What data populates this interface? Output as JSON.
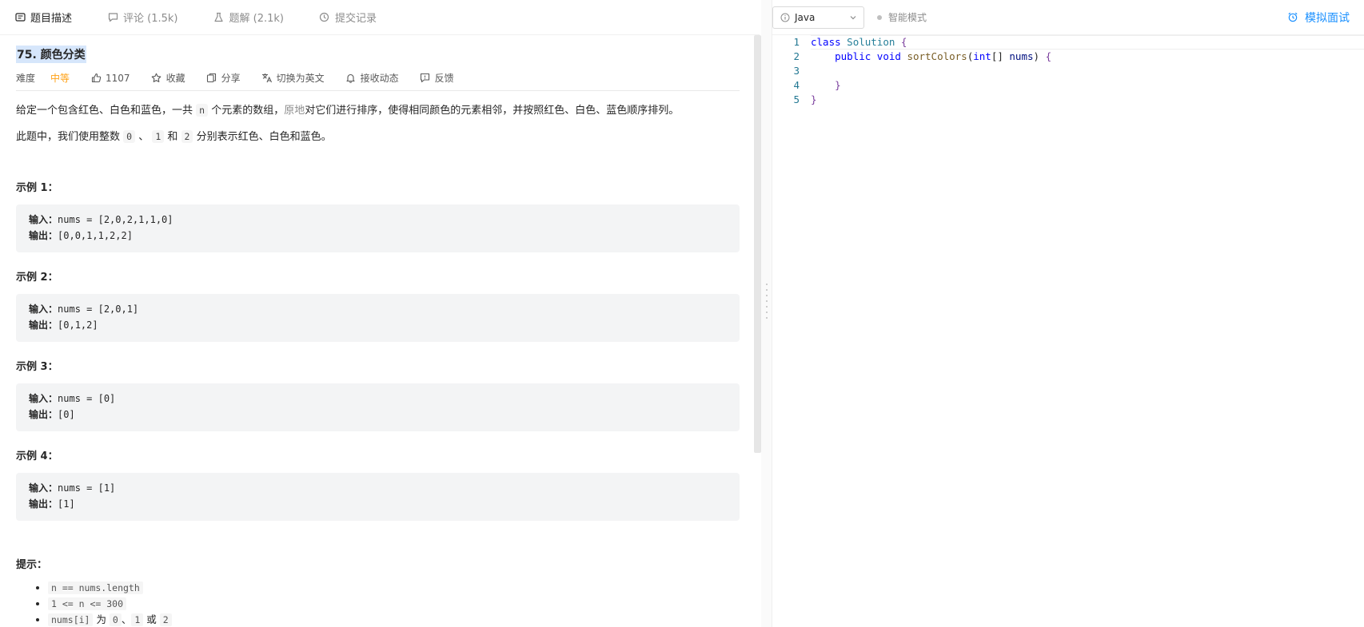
{
  "tabs": [
    {
      "label": "题目描述",
      "icon": "description-icon",
      "active": true
    },
    {
      "label": "评论 (1.5k)",
      "icon": "comment-icon",
      "active": false
    },
    {
      "label": "题解 (2.1k)",
      "icon": "flask-icon",
      "active": false
    },
    {
      "label": "提交记录",
      "icon": "clock-icon",
      "active": false
    }
  ],
  "problem": {
    "title": "75. 颜色分类",
    "difficulty_label": "难度",
    "difficulty": "中等",
    "likes": "1107",
    "actions": {
      "favorite": "收藏",
      "share": "分享",
      "switch_lang": "切换为英文",
      "subscribe": "接收动态",
      "feedback": "反馈"
    },
    "desc1": {
      "p1": "给定一个包含红色、白色和蓝色，一共 ",
      "code1": "n",
      "p2": " 个元素的数组，",
      "link": "原地",
      "p3": "对它们进行排序，使得相同颜色的元素相邻，并按照红色、白色、蓝色顺序排列。"
    },
    "desc2": {
      "p1": "此题中，我们使用整数 ",
      "c0": "0",
      "sep1": " 、 ",
      "c1": "1",
      "sep2": " 和 ",
      "c2": "2",
      "p2": " 分别表示红色、白色和蓝色。"
    },
    "input_label": "输入：",
    "output_label": "输出：",
    "examples": [
      {
        "title": "示例 1：",
        "input": "nums = [2,0,2,1,1,0]",
        "output": "[0,0,1,1,2,2]"
      },
      {
        "title": "示例 2：",
        "input": "nums = [2,0,1]",
        "output": "[0,1,2]"
      },
      {
        "title": "示例 3：",
        "input": "nums = [0]",
        "output": "[0]"
      },
      {
        "title": "示例 4：",
        "input": "nums = [1]",
        "output": "[1]"
      }
    ],
    "hints_title": "提示：",
    "hints": {
      "h1": "n == nums.length",
      "h2": "1 <= n <= 300",
      "h3a": "nums[i]",
      "h3b": " 为 ",
      "h3c": "0",
      "h3d": "、",
      "h3e": "1",
      "h3f": " 或 ",
      "h3g": "2"
    }
  },
  "editor": {
    "language": "Java",
    "smart_mode": "智能模式",
    "mock_interview": "模拟面试",
    "code": {
      "l1a": "class",
      "l1b": "Solution",
      "l1c": "{",
      "l2a": "public",
      "l2b": "void",
      "l2c": "sortColors",
      "l2d": "(",
      "l2e": "int",
      "l2f": "[]",
      "l2g": "nums",
      "l2h": ")",
      "l2i": "{",
      "l4a": "}",
      "l5a": "}"
    },
    "line_numbers": [
      "1",
      "2",
      "3",
      "4",
      "5"
    ]
  },
  "colors": {
    "accent": "#1a90ff",
    "difficulty_medium": "#ffa116",
    "title_highlight": "#d6e6fb",
    "example_bg": "#f3f4f5"
  }
}
